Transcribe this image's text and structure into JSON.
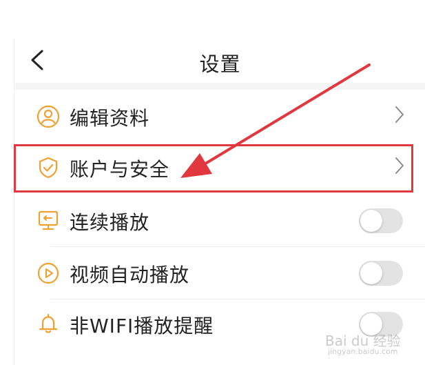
{
  "header": {
    "title": "设置"
  },
  "settings": {
    "items": [
      {
        "label": "编辑资料",
        "control": "chevron",
        "icon": "user-icon"
      },
      {
        "label": "账户与安全",
        "control": "chevron",
        "icon": "shield-check-icon"
      },
      {
        "label": "连续播放",
        "control": "toggle",
        "on": false,
        "icon": "monitor-icon"
      },
      {
        "label": "视频自动播放",
        "control": "toggle",
        "on": false,
        "icon": "play-circle-icon"
      },
      {
        "label": "非WIFI播放提醒",
        "control": "toggle",
        "on": false,
        "icon": "bell-icon"
      }
    ]
  },
  "colors": {
    "accent": "#f0a030",
    "highlight": "#e0383e",
    "text": "#222222"
  },
  "watermark": {
    "brand": "Bai du 经验",
    "url": "jingyan.baidu.com"
  }
}
